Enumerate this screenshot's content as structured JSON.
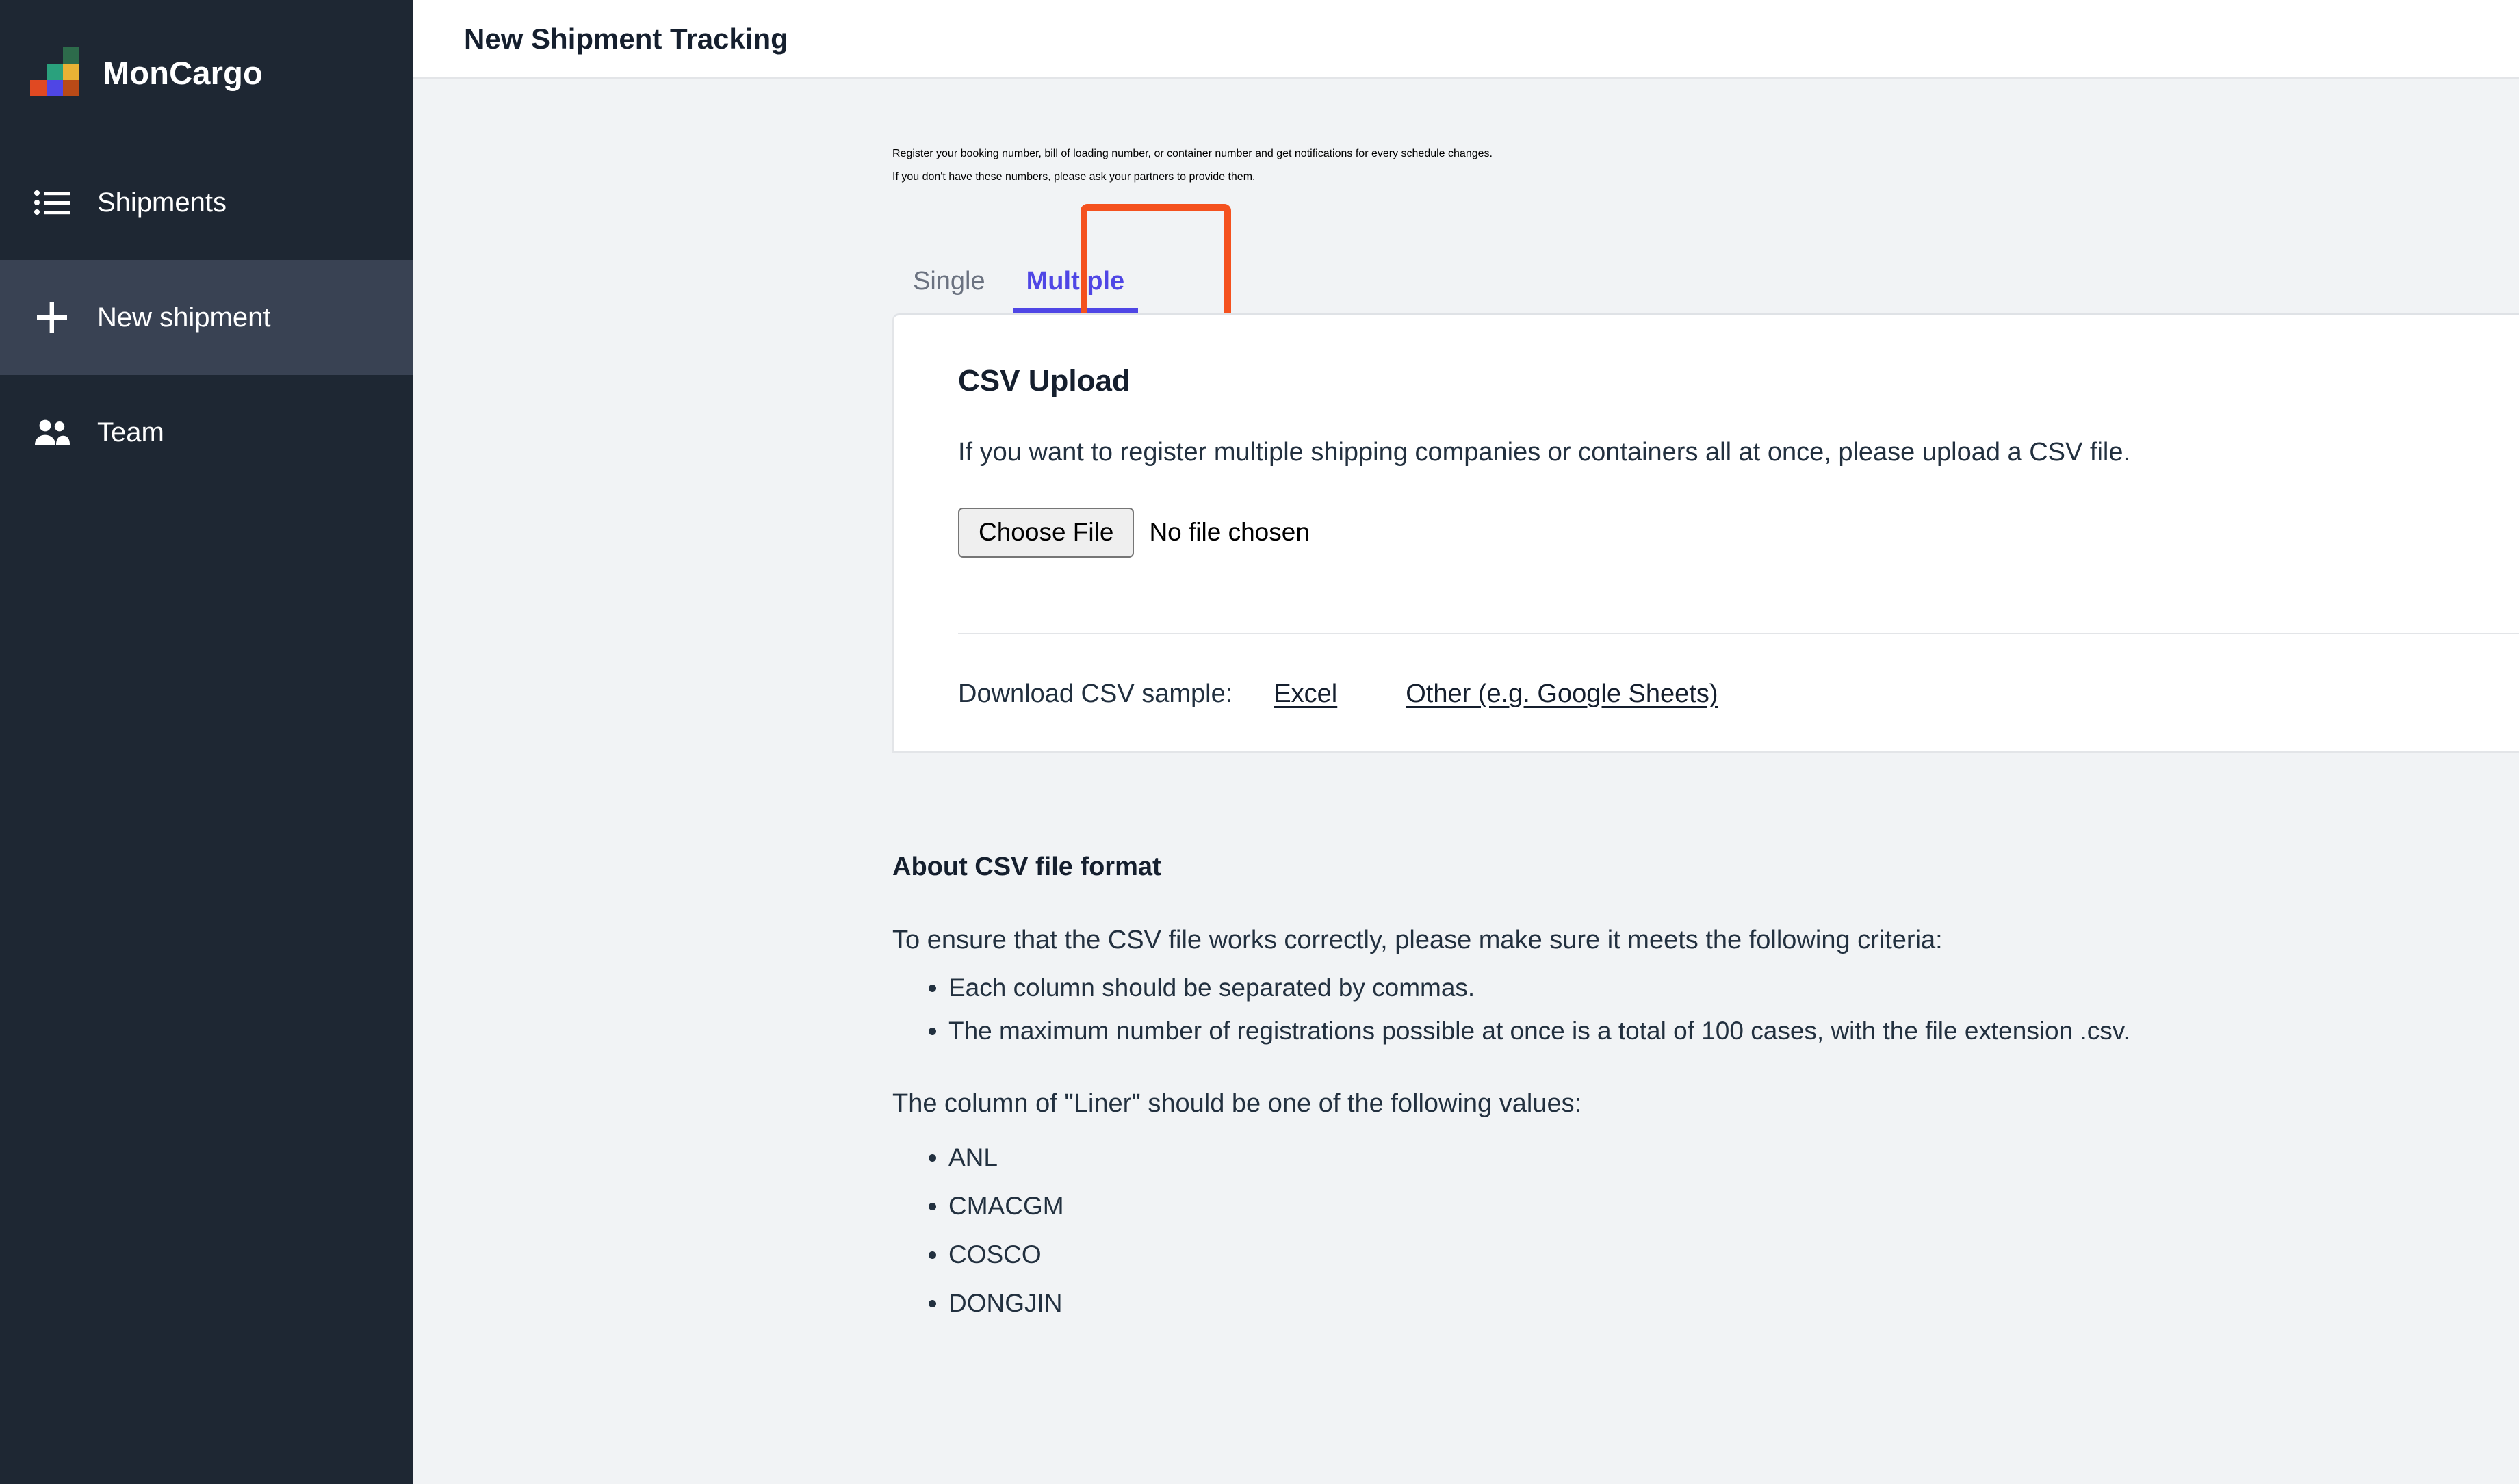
{
  "sidebar": {
    "brand": {
      "name": "MonCargo",
      "logo_icon": "moncargo-blocks-logo"
    },
    "items": [
      {
        "label": "Shipments",
        "icon": "list-icon",
        "active": false
      },
      {
        "label": "New shipment",
        "icon": "plus-icon",
        "active": true
      },
      {
        "label": "Team",
        "icon": "people-icon",
        "active": false
      }
    ]
  },
  "header": {
    "title": "New Shipment Tracking"
  },
  "intro": {
    "line1": "Register your booking number, bill of loading number, or container number and get notifications for every schedule changes.",
    "line2": "If you don't have these numbers, please ask your partners to provide them."
  },
  "tabs": {
    "items": [
      {
        "label": "Single",
        "active": false
      },
      {
        "label": "Multiple",
        "active": true
      }
    ],
    "highlight_color": "#f4511e",
    "active_color": "#4f46e5"
  },
  "csv_upload": {
    "title": "CSV Upload",
    "description": "If you want to register multiple shipping companies or containers all at once, please upload a CSV file.",
    "choose_file_button": "Choose File",
    "file_status": "No file chosen",
    "download_label": "Download CSV sample:",
    "links": [
      {
        "label": "Excel"
      },
      {
        "label": "Other (e.g. Google Sheets)"
      }
    ]
  },
  "about": {
    "title": "About CSV file format",
    "intro": "To ensure that the CSV file works correctly, please make sure it meets the following criteria:",
    "criteria": [
      "Each column should be separated by commas.",
      "The maximum number of registrations possible at once is a total of 100 cases, with the file extension .csv."
    ],
    "liner_intro": "The column of \"Liner\" should be one of the following values:",
    "liners": [
      "ANL",
      "CMACGM",
      "COSCO",
      "DONGJIN"
    ]
  }
}
